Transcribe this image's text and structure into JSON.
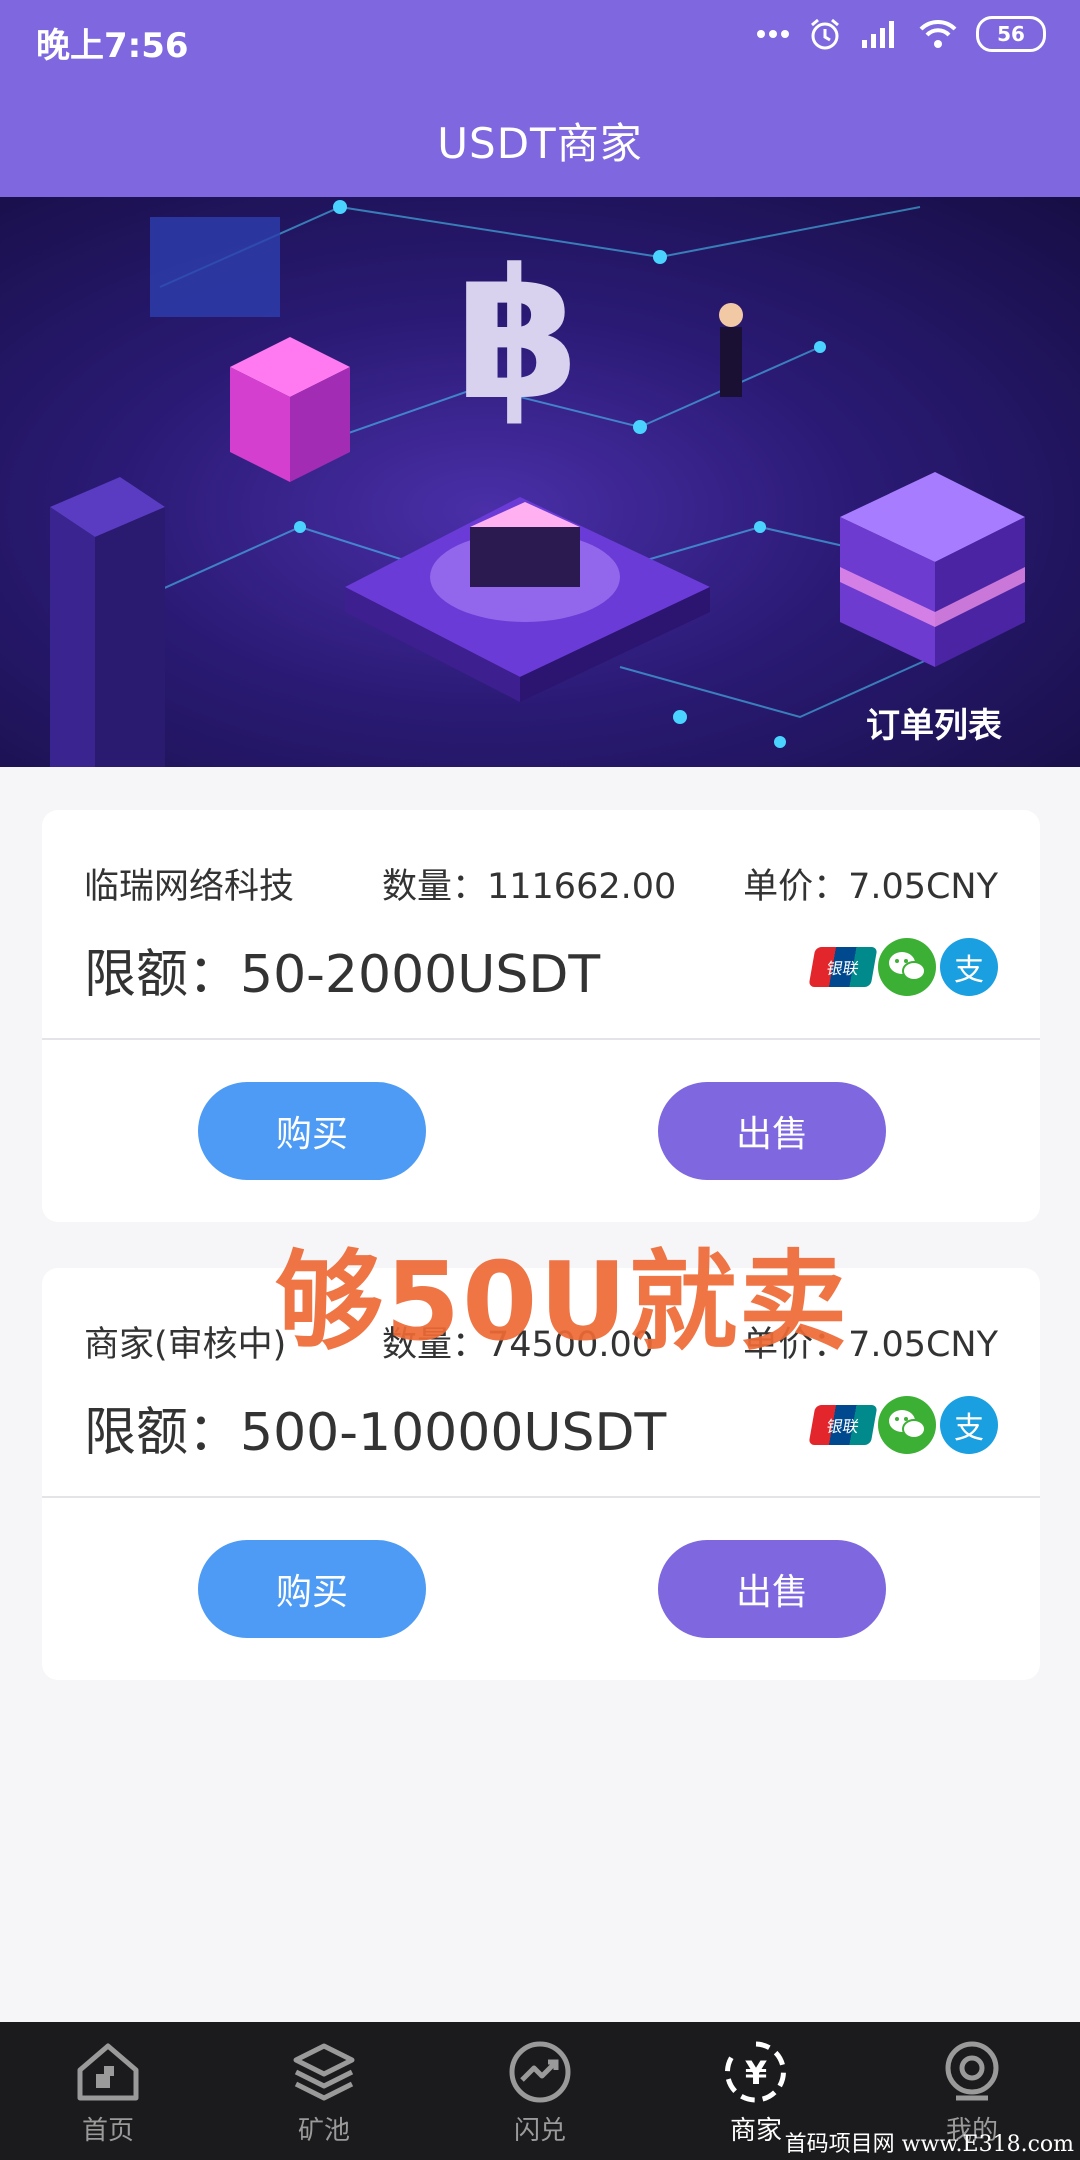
{
  "status_bar": {
    "time": "晚上7:56",
    "battery": "56"
  },
  "header": {
    "title": "USDT商家"
  },
  "banner": {
    "order_list_label": "订单列表"
  },
  "merchants": [
    {
      "name": "临瑞网络科技",
      "quantity": "数量：111662.00",
      "price": "单价：7.05CNY",
      "limit": "限额：50-2000USDT",
      "buy_label": "购买",
      "sell_label": "出售"
    },
    {
      "name": "商家(审核中)",
      "quantity": "数量：74500.00",
      "price": "单价：7.05CNY",
      "limit": "限额：500-10000USDT",
      "buy_label": "购买",
      "sell_label": "出售"
    }
  ],
  "pay_icons": {
    "unionpay": "银联",
    "alipay": "支",
    "wechat_icon": "wechat-icon"
  },
  "overlay_text": "够50U就卖",
  "nav": [
    {
      "label": "首页",
      "icon": "home-icon"
    },
    {
      "label": "矿池",
      "icon": "layers-icon"
    },
    {
      "label": "闪兑",
      "icon": "trend-icon"
    },
    {
      "label": "商家",
      "icon": "merchant-icon",
      "active": true
    },
    {
      "label": "我的",
      "icon": "profile-icon"
    }
  ],
  "site_watermark": "首码项目网 www.E318.com",
  "colors": {
    "primary": "#7f67e0",
    "buy": "#4e9bf5",
    "overlay": "#ee6a36"
  }
}
